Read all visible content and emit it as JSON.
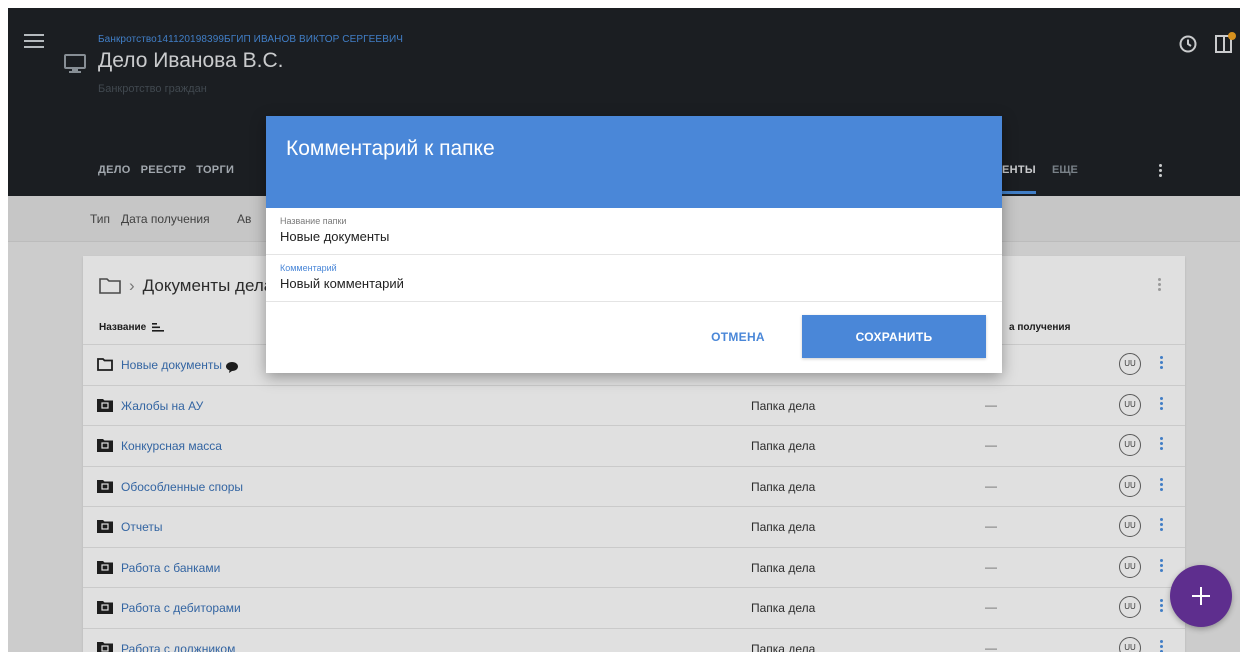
{
  "header": {
    "case_code": "Банкротство141120198399БГИП ИВАНОВ ВИКТОР СЕРГЕЕВИЧ",
    "case_title": "Дело Иванова В.С.",
    "case_type": "Банкротство граждан",
    "tabs": [
      "ДЕЛО",
      "РЕЕСТР",
      "ТОРГИ"
    ],
    "active_tab_visible": "ЕНТЫ",
    "more_tab": "ЕЩЕ"
  },
  "filters": [
    "Тип",
    "Дата получения",
    "Ав"
  ],
  "card": {
    "breadcrumb": "Документы дела",
    "col_name": "Название",
    "col_date_visible": "а получения",
    "rows": [
      {
        "name": "Новые документы",
        "type": "",
        "date": "",
        "badge": "UU",
        "has_comment": true
      },
      {
        "name": "Жалобы на АУ",
        "type": "Папка дела",
        "date": "—",
        "badge": "UU"
      },
      {
        "name": "Конкурсная масса",
        "type": "Папка дела",
        "date": "—",
        "badge": "UU"
      },
      {
        "name": "Обособленные споры",
        "type": "Папка дела",
        "date": "—",
        "badge": "UU"
      },
      {
        "name": "Отчеты",
        "type": "Папка дела",
        "date": "—",
        "badge": "UU"
      },
      {
        "name": "Работа с банками",
        "type": "Папка дела",
        "date": "—",
        "badge": "UU"
      },
      {
        "name": "Работа с дебиторами",
        "type": "Папка дела",
        "date": "—",
        "badge": "UU"
      },
      {
        "name": "Работа с должником",
        "type": "Папка дела",
        "date": "—",
        "badge": "UU"
      }
    ]
  },
  "dialog": {
    "title": "Комментарий к папке",
    "folder_label": "Название папки",
    "folder_value": "Новые документы",
    "comment_label": "Комментарий",
    "comment_value": "Новый комментарий",
    "cancel_label": "ОТМЕНА",
    "save_label": "СОХРАНИТЬ"
  },
  "colors": {
    "accent": "#4a87d8",
    "header_bg": "#1f2327",
    "fab": "#5e2e8e"
  }
}
